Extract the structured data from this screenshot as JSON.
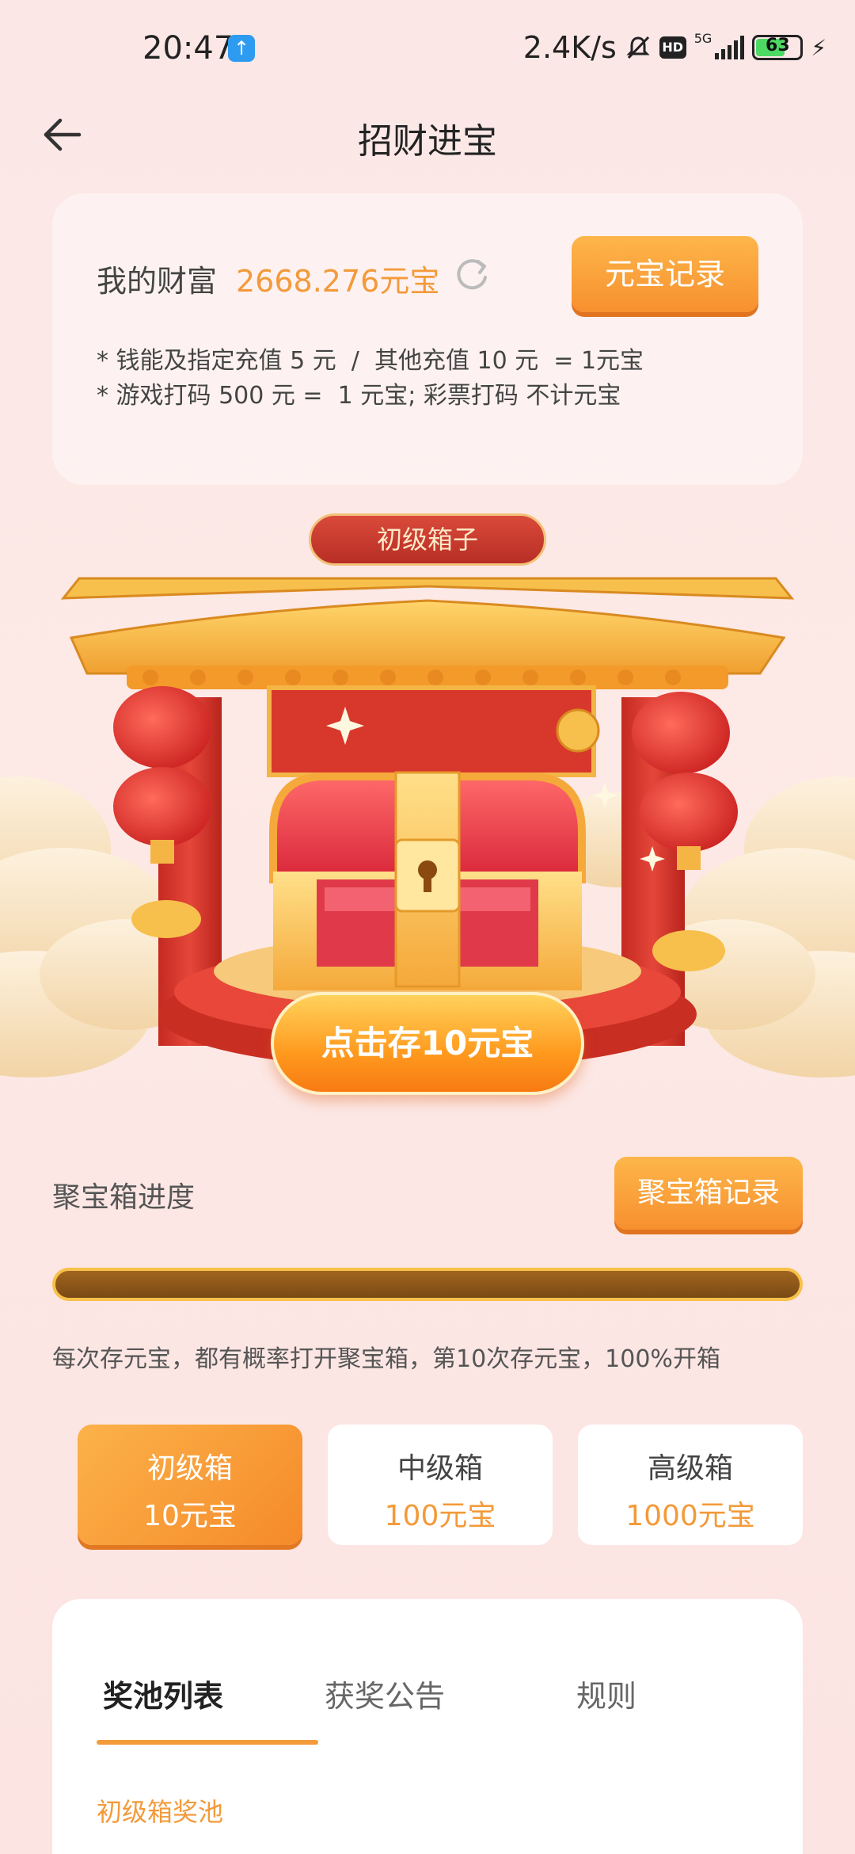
{
  "status_bar": {
    "time": "20:47",
    "net_speed": "2.4K/s",
    "battery": "63",
    "icons": [
      "upload-icon",
      "mute-icon",
      "hd-icon",
      "5g-signal-icon",
      "battery-icon",
      "charging-icon"
    ]
  },
  "header": {
    "title": "招财进宝",
    "back_icon": "arrow-left-icon"
  },
  "wealth": {
    "label": "我的财富",
    "value": "2668.276元宝",
    "record_button": "元宝记录",
    "note_1": "* 钱能及指定充值 5 元  /  其他充值 10 元  = 1元宝",
    "note_2": "* 游戏打码 500 元 =  1 元宝; 彩票打码 不计元宝"
  },
  "scene": {
    "box_tag": "初级箱子",
    "deposit_button": "点击存10元宝"
  },
  "progress": {
    "label": "聚宝箱进度",
    "record_button": "聚宝箱记录",
    "value": 0,
    "tip": "每次存元宝，都有概率打开聚宝箱，第10次存元宝，100%开箱"
  },
  "tiers": [
    {
      "name": "初级箱",
      "price": "10元宝",
      "active": true
    },
    {
      "name": "中级箱",
      "price": "100元宝",
      "active": false
    },
    {
      "name": "高级箱",
      "price": "1000元宝",
      "active": false
    }
  ],
  "tabs": [
    {
      "label": "奖池列表",
      "active": true
    },
    {
      "label": "获奖公告",
      "active": false
    },
    {
      "label": "规则",
      "active": false
    }
  ],
  "pool_title": "初级箱奖池",
  "colors": {
    "accent": "#f39a3a",
    "button_gradient_top": "#fdb64a",
    "button_gradient_bottom": "#f7902e",
    "temple_red": "#d8382c",
    "roof_gold": "#f4b545"
  }
}
